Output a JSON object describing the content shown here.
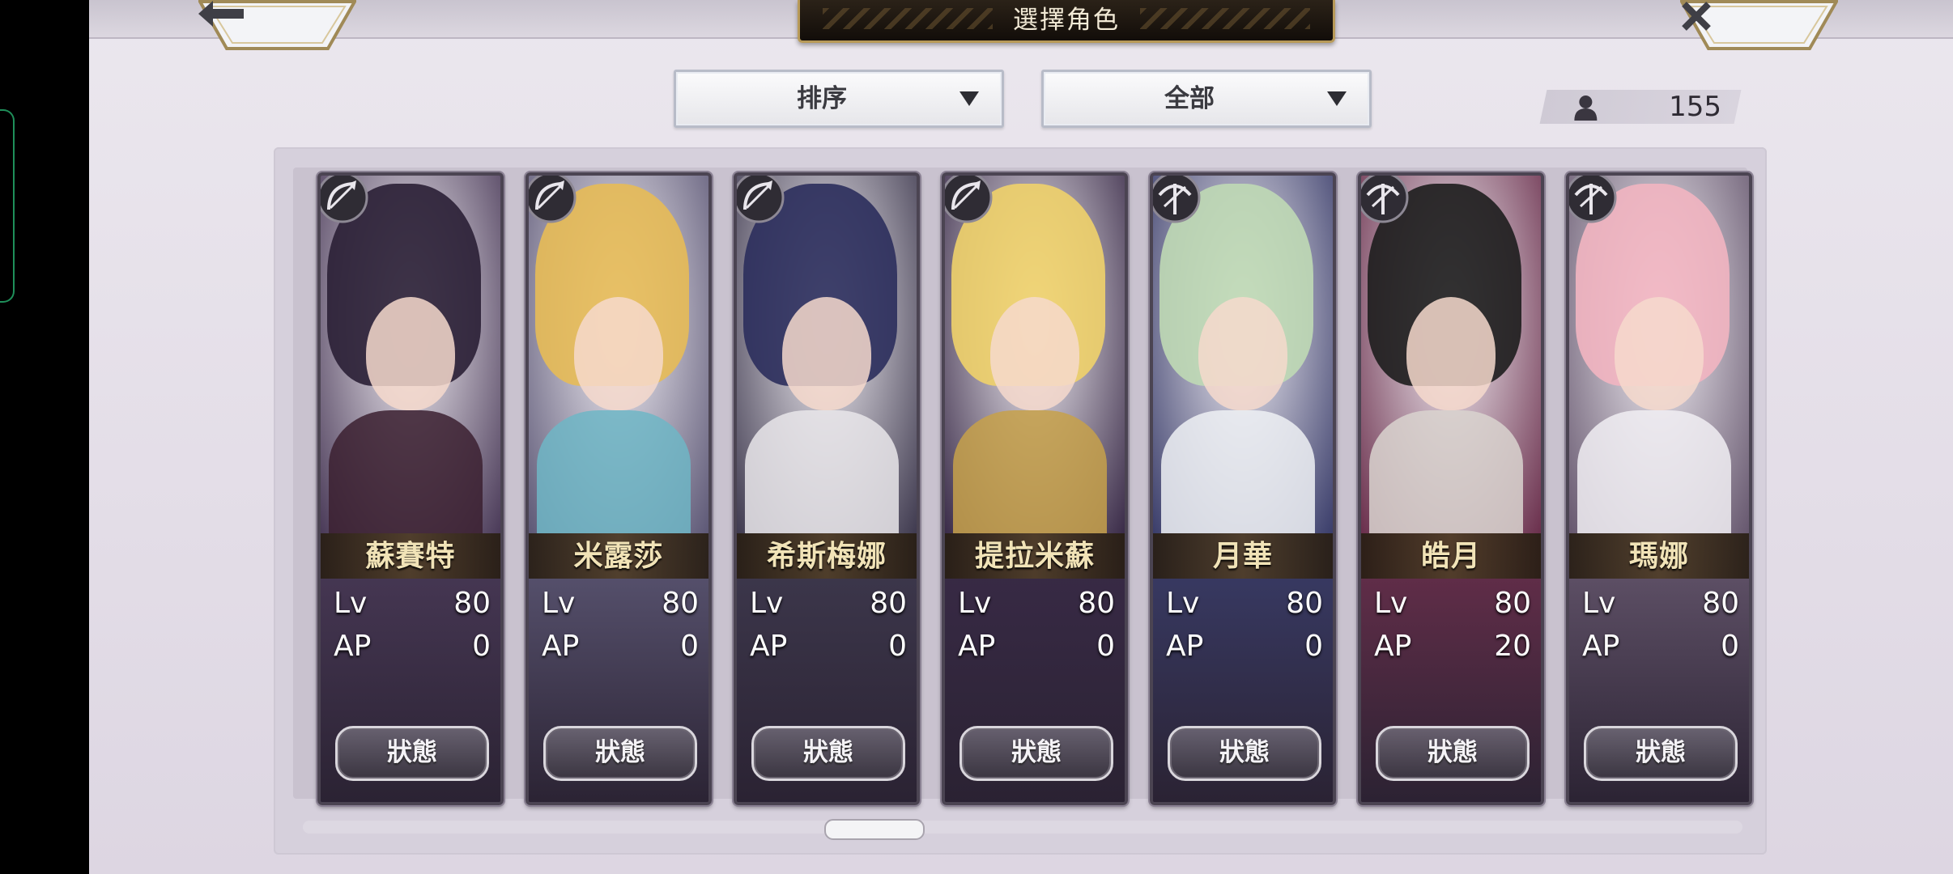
{
  "header": {
    "title": "選擇角色",
    "back_icon": "arrow-left-icon",
    "close_icon": "close-x-icon"
  },
  "controls": {
    "sort_label": "排序",
    "filter_label": "全部",
    "unit_count": "155",
    "count_icon": "person-icon"
  },
  "labels": {
    "lv": "Lv",
    "ap": "AP",
    "status": "狀態"
  },
  "characters": [
    {
      "name": "蘇賽特",
      "lv": "80",
      "ap": "0",
      "class": "bow-icon",
      "hair": "#2a1f35",
      "outfit": "#3b2030",
      "bg": "#4a3a58"
    },
    {
      "name": "米露莎",
      "lv": "80",
      "ap": "0",
      "class": "bow-icon",
      "hair": "#e7bb56",
      "outfit": "#6fb6c5",
      "bg": "#5d5876"
    },
    {
      "name": "希斯梅娜",
      "lv": "80",
      "ap": "0",
      "class": "bow-icon",
      "hair": "#2b2d5c",
      "outfit": "#e9e6ea",
      "bg": "#3f3a4f"
    },
    {
      "name": "提拉米蘇",
      "lv": "80",
      "ap": "0",
      "class": "bow-icon",
      "hair": "#f0d26a",
      "outfit": "#c7a14a",
      "bg": "#3a2b48"
    },
    {
      "name": "月華",
      "lv": "80",
      "ap": "0",
      "class": "crossbow-icon",
      "hair": "#bfd9b5",
      "outfit": "#eef1f5",
      "bg": "#3a3d6a"
    },
    {
      "name": "皓月",
      "lv": "80",
      "ap": "20",
      "class": "crossbow-icon",
      "hair": "#1d1d1d",
      "outfit": "#d9d3cf",
      "bg": "#6a2f4c"
    },
    {
      "name": "瑪娜",
      "lv": "80",
      "ap": "0",
      "class": "crossbow-icon",
      "hair": "#f2b5c1",
      "outfit": "#f1eef3",
      "bg": "#66576e"
    }
  ]
}
